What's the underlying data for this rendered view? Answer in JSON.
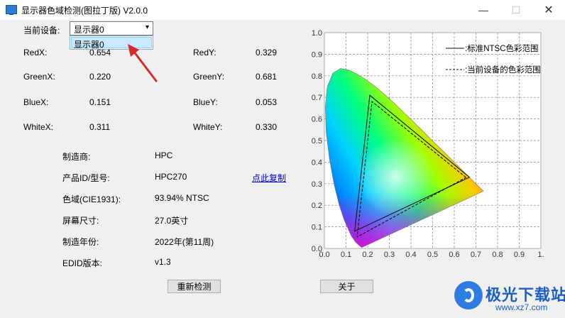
{
  "window": {
    "title": "显示器色域检测(图拉丁版) V2.0.0",
    "min_glyph": "—",
    "max_glyph": "☐",
    "close_glyph": "✕"
  },
  "device": {
    "label": "当前设备:",
    "selected": "显示器0",
    "options": [
      "显示器0"
    ]
  },
  "coords": [
    {
      "label": "RedX:",
      "value": "0.654"
    },
    {
      "label": "RedY:",
      "value": "0.329"
    },
    {
      "label": "GreenX:",
      "value": "0.220"
    },
    {
      "label": "GreenY:",
      "value": "0.681"
    },
    {
      "label": "BlueX:",
      "value": "0.151"
    },
    {
      "label": "BlueY:",
      "value": "0.053"
    },
    {
      "label": "WhiteX:",
      "value": "0.311"
    },
    {
      "label": "WhiteY:",
      "value": "0.330"
    }
  ],
  "info": [
    {
      "label": "制造商:",
      "value": "HPC"
    },
    {
      "label": "产品ID/型号:",
      "value": "HPC270"
    },
    {
      "label": "色域(CIE1931):",
      "value": "93.94% NTSC"
    },
    {
      "label": "屏幕尺寸:",
      "value": "27.0英寸"
    },
    {
      "label": "制造年份:",
      "value": "2022年(第11周)"
    },
    {
      "label": "EDID版本:",
      "value": "v1.3"
    }
  ],
  "copy_link": "点此复制",
  "buttons": {
    "redetect": "重新检测",
    "about": "关于"
  },
  "chart_data": {
    "type": "line",
    "xlim": [
      0,
      1
    ],
    "ylim": [
      0,
      1
    ],
    "x_ticks": [
      "0.0",
      "0.1",
      "0.2",
      "0.3",
      "0.4",
      "0.5",
      "0.6",
      "0.7",
      "0.8",
      "0.9",
      "1."
    ],
    "y_ticks": [
      "0.0",
      "0.1",
      "0.2",
      "0.3",
      "0.4",
      "0.5",
      "0.6",
      "0.7",
      "0.8",
      "0.9",
      "1.0"
    ],
    "grid": true,
    "legend_position": "top-right",
    "series": [
      {
        "name": "标准NTSC色彩范围",
        "style": "solid",
        "x": [
          0.67,
          0.21,
          0.14,
          0.67
        ],
        "y": [
          0.33,
          0.71,
          0.08,
          0.33
        ]
      },
      {
        "name": "当前设备的色彩范围",
        "style": "dashed",
        "x": [
          0.654,
          0.22,
          0.151,
          0.654
        ],
        "y": [
          0.329,
          0.681,
          0.053,
          0.329
        ]
      }
    ],
    "spectral_locus": {
      "x": [
        0.1741,
        0.1738,
        0.1726,
        0.1689,
        0.1644,
        0.1566,
        0.144,
        0.1241,
        0.0913,
        0.0687,
        0.0454,
        0.0235,
        0.0082,
        0.0039,
        0.0139,
        0.0389,
        0.0743,
        0.1142,
        0.1547,
        0.1929,
        0.2296,
        0.2658,
        0.3016,
        0.3373,
        0.3731,
        0.4087,
        0.4441,
        0.4788,
        0.5125,
        0.5448,
        0.5752,
        0.6029,
        0.627,
        0.6482,
        0.6658,
        0.6801,
        0.6915,
        0.7006,
        0.7079,
        0.714,
        0.719,
        0.723,
        0.726,
        0.7347
      ],
      "y": [
        0.005,
        0.0049,
        0.0048,
        0.0069,
        0.0109,
        0.0177,
        0.0297,
        0.0578,
        0.1327,
        0.2007,
        0.295,
        0.4127,
        0.5384,
        0.6548,
        0.7502,
        0.812,
        0.8338,
        0.8262,
        0.8059,
        0.7816,
        0.7543,
        0.7243,
        0.6923,
        0.6589,
        0.6245,
        0.5896,
        0.5547,
        0.5202,
        0.4866,
        0.4544,
        0.4242,
        0.3965,
        0.3725,
        0.3514,
        0.334,
        0.3197,
        0.3083,
        0.2993,
        0.292,
        0.2859,
        0.2809,
        0.277,
        0.274,
        0.2653
      ]
    }
  },
  "colors": {
    "background": "#f0f0f0",
    "link": "#0000ee",
    "arrow": "#d42a2a",
    "watermark": "#1a5fc9"
  }
}
